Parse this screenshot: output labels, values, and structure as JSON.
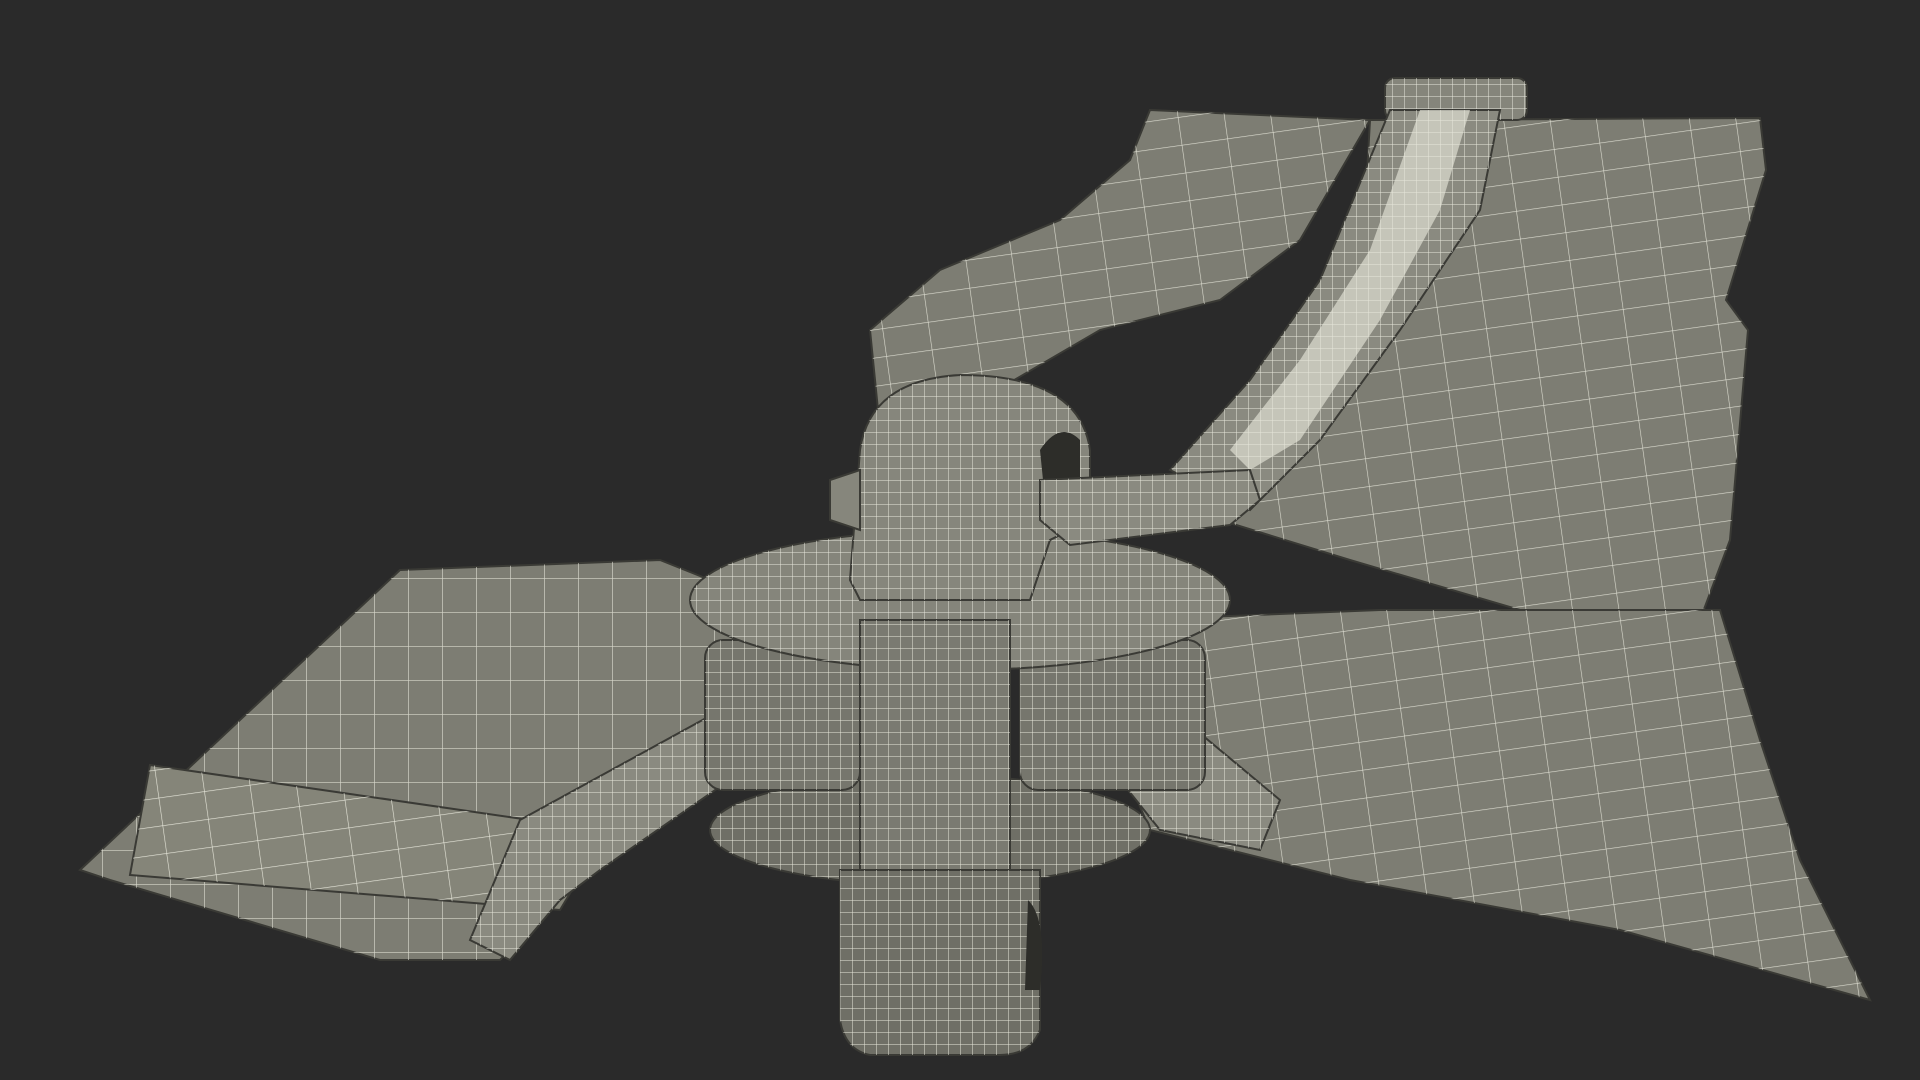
{
  "scene": {
    "subject": "zipper-slider-wireframe",
    "render_style": "gray-shaded with white wireframe",
    "colors": {
      "background": "#2a2a2a",
      "surface": "#7d7d73",
      "surface_light": "#8a8a80",
      "surface_dark": "#65655c",
      "wire": "#e8e8dc",
      "edge": "#3a3a35"
    }
  }
}
